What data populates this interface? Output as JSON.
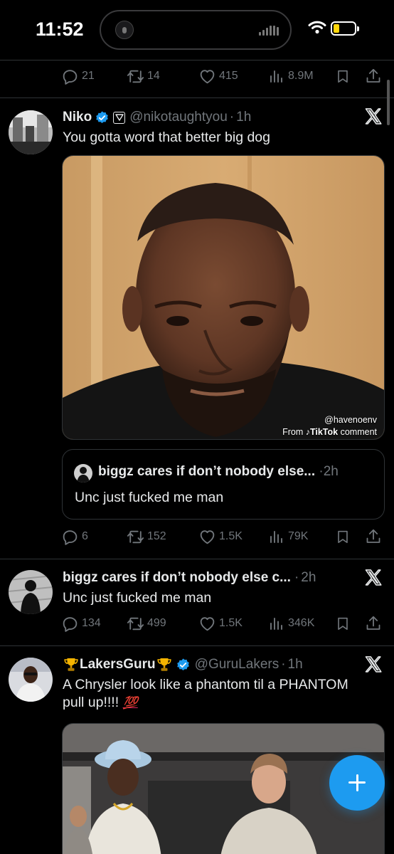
{
  "status_bar": {
    "time": "11:52",
    "battery_level": 0.3
  },
  "top_actions": {
    "replies": "21",
    "reposts": "14",
    "likes": "415",
    "views": "8.9M"
  },
  "tweets": [
    {
      "name": "Niko",
      "handle": "@nikotaughtyou",
      "time": "1h",
      "text": "You gotta word that better big dog",
      "media": {
        "watermark_user": "@havenoenv",
        "watermark_from": "From",
        "watermark_brand": "TikTok",
        "watermark_suffix": "comment"
      },
      "quote": {
        "name": "biggz cares if don’t nobody else...",
        "time": "2h",
        "text": "Unc just fucked me man"
      },
      "actions": {
        "replies": "6",
        "reposts": "152",
        "likes": "1.5K",
        "views": "79K"
      }
    },
    {
      "name": "biggz cares if don’t nobody else c...",
      "handle": "",
      "time": "2h",
      "text": "Unc just fucked me man",
      "actions": {
        "replies": "134",
        "reposts": "499",
        "likes": "1.5K",
        "views": "346K"
      }
    },
    {
      "name": "LakersGuru",
      "handle": "@GuruLakers",
      "time": "1h",
      "text_line1": "A Chrysler look like a phantom til a PHANTOM",
      "text_line2": "pull up!!!!",
      "emoji": "💯"
    }
  ],
  "icons": [
    "reply-icon",
    "repost-icon",
    "like-icon",
    "views-icon",
    "bookmark-icon",
    "share-icon",
    "x-logo-icon",
    "verified-badge-icon",
    "compose-icon"
  ],
  "colors": {
    "accent": "#1d9bf0",
    "muted": "#71767b",
    "text": "#e7e9ea",
    "border": "#2f3336",
    "trophy": "#f5b400"
  }
}
